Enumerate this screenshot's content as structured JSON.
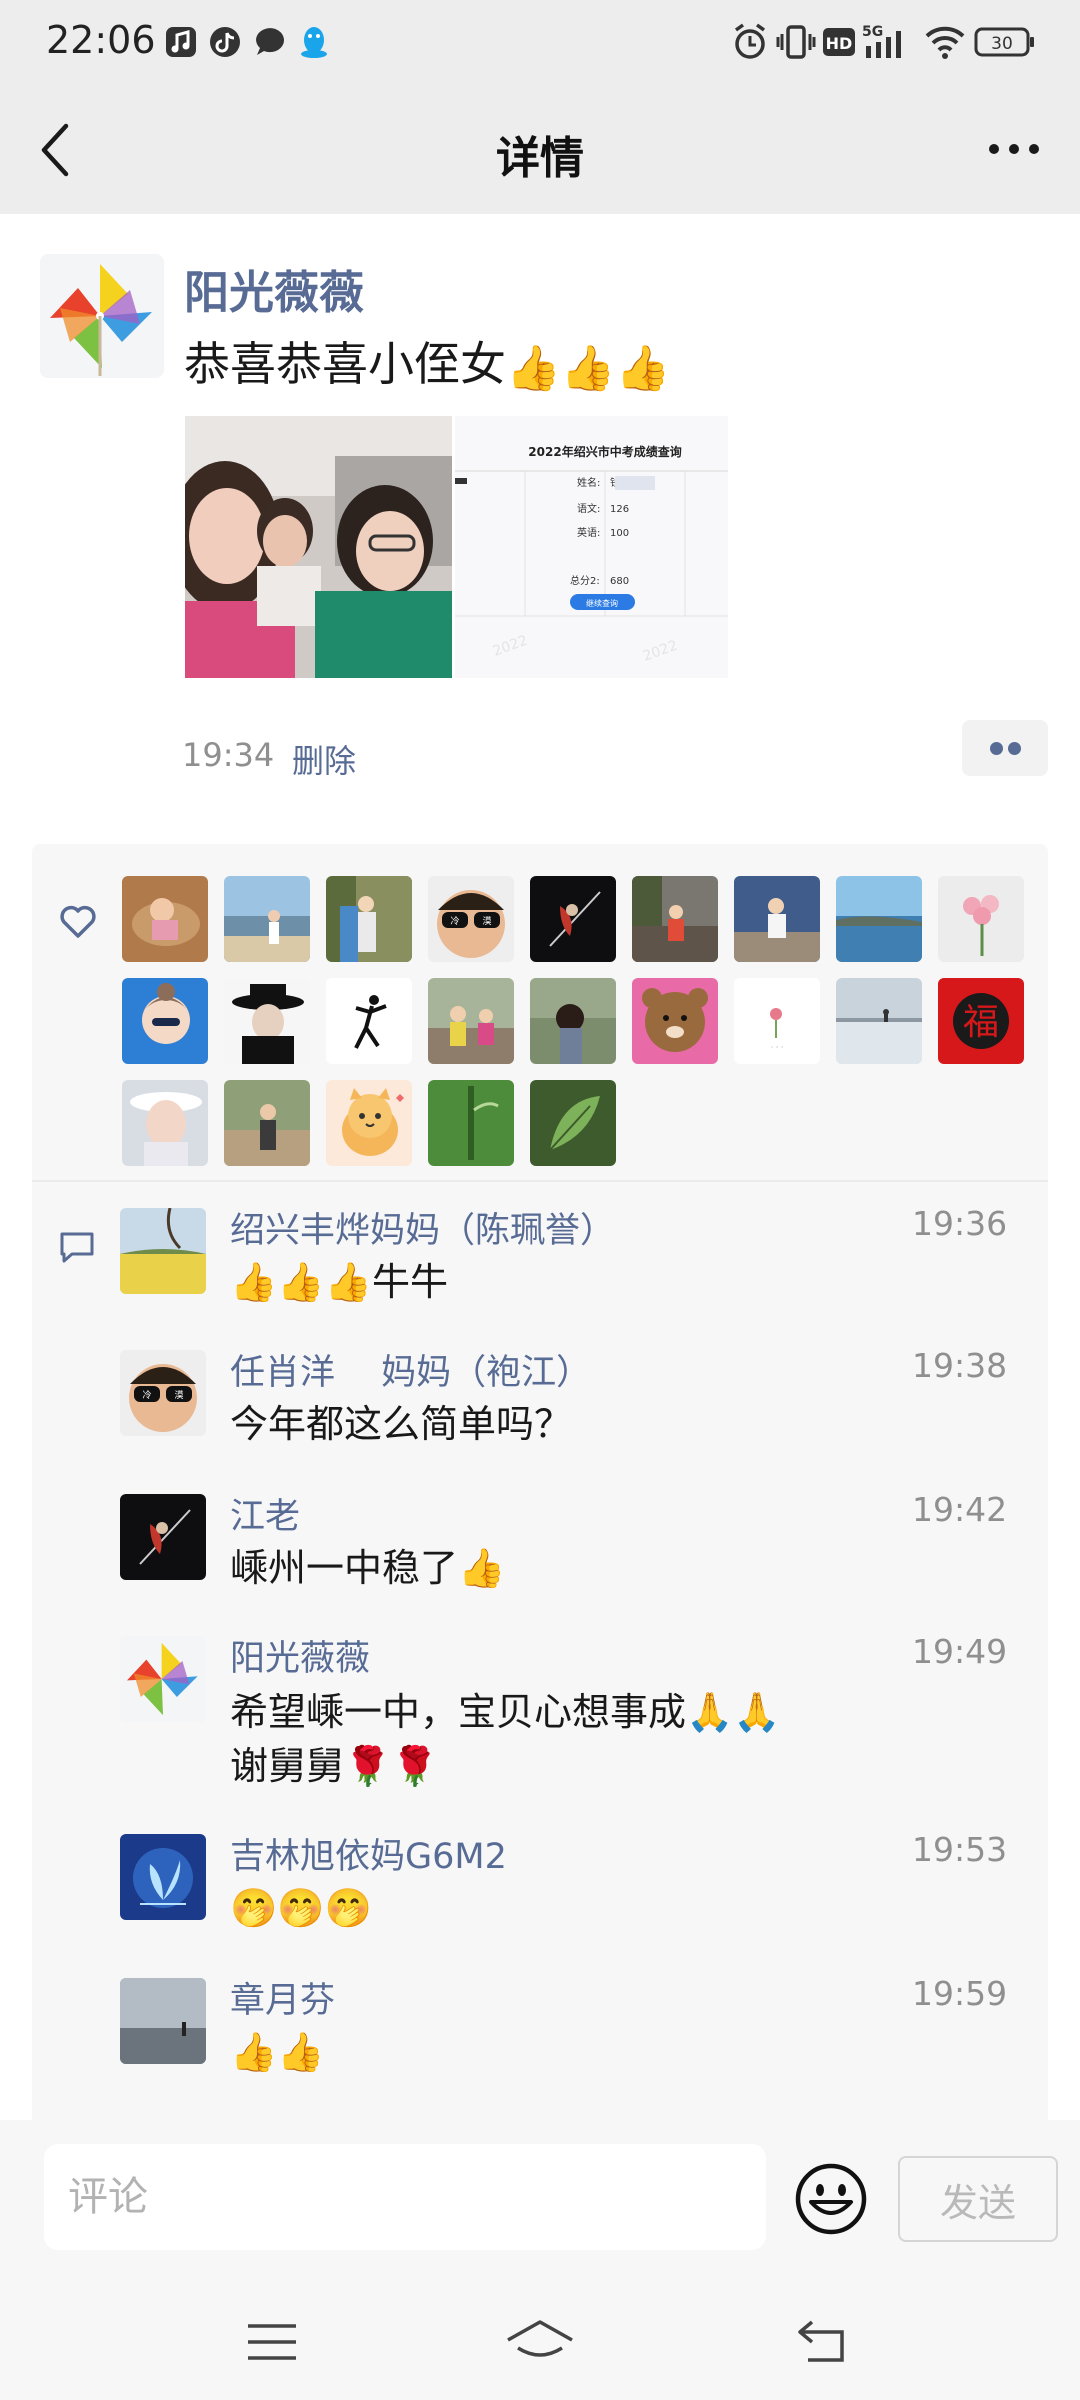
{
  "status_bar": {
    "time": "22:06",
    "battery": "30",
    "network": "5G",
    "hd": "HD",
    "left_icons": [
      "music-app-icon",
      "tiktok-icon",
      "chat-bubble-icon",
      "qq-penguin-icon"
    ],
    "right_icons": [
      "alarm-icon",
      "vibrate-icon",
      "hd-icon",
      "signal-icon",
      "wifi-icon",
      "battery-icon"
    ]
  },
  "nav": {
    "title": "详情",
    "back_icon": "chevron-left-icon",
    "more_icon": "more-dots-icon"
  },
  "post": {
    "author": "阳光薇薇",
    "text": "恭喜恭喜小侄女",
    "text_emoji": "👍👍👍",
    "time": "19:34",
    "delete_label": "删除",
    "score_card": {
      "title": "2022年绍兴市中考成绩查询",
      "rows": [
        {
          "label": "姓名:",
          "value": "钱"
        },
        {
          "label": "语文:",
          "value": "126"
        },
        {
          "label": "英语:",
          "value": "100"
        },
        {
          "label": "总分2:",
          "value": "680"
        }
      ],
      "button": "继续查询"
    }
  },
  "likes": {
    "icon": "heart-outline-icon",
    "count": 23
  },
  "comments": [
    {
      "name": "绍兴丰烨妈妈（陈珮誉）",
      "time": "19:36",
      "lines": [
        "👍👍👍牛牛"
      ]
    },
    {
      "name": "任肖洋　 妈妈（袍江）",
      "time": "19:38",
      "lines": [
        "今年都这么简单吗？"
      ]
    },
    {
      "name": "江老",
      "time": "19:42",
      "lines": [
        "嵊州一中稳了👍"
      ]
    },
    {
      "name": "阳光薇薇",
      "time": "19:49",
      "lines": [
        "希望嵊一中，宝贝心想事成🙏🙏",
        "谢舅舅🌹🌹"
      ]
    },
    {
      "name": "吉林旭依妈G6M2",
      "time": "19:53",
      "lines": [
        "🤭🤭🤭"
      ]
    },
    {
      "name": "章月芬",
      "time": "19:59",
      "lines": [
        "👍👍"
      ]
    }
  ],
  "input": {
    "placeholder": "评论",
    "send_label": "发送",
    "emoji_icon": "smiley-face-icon"
  },
  "system_nav": {
    "icons": [
      "menu-icon",
      "home-icon",
      "back-arrow-icon"
    ]
  },
  "colors": {
    "link_blue": "#576b95",
    "nav_bg": "#ededed",
    "panel_bg": "#f7f7f7"
  }
}
